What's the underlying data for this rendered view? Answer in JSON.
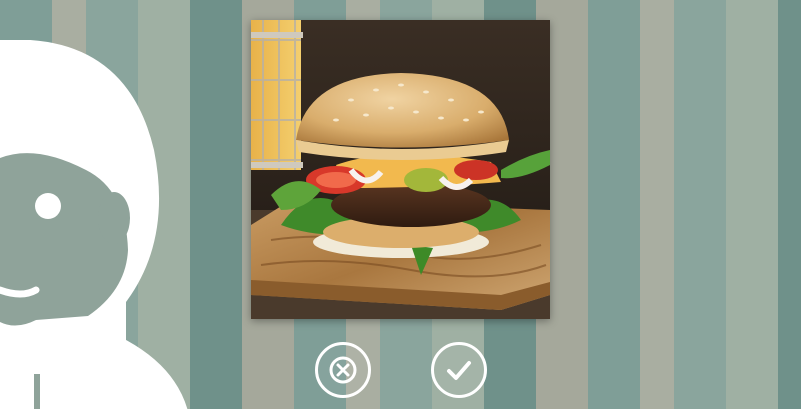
{
  "background": {
    "stripe_colors": [
      "#7f9e97",
      "#a9aea1",
      "#8aa59d",
      "#9fb0a3",
      "#6f918a",
      "#a5a89b"
    ]
  },
  "mascot": {
    "icon": "person-silhouette-icon",
    "color": "#ffffff"
  },
  "photo": {
    "subject": "burger-photo",
    "icon": "burger-image"
  },
  "actions": {
    "reject": {
      "icon": "close-icon",
      "color": "#ffffff"
    },
    "accept": {
      "icon": "checkmark-icon",
      "color": "#ffffff"
    }
  }
}
